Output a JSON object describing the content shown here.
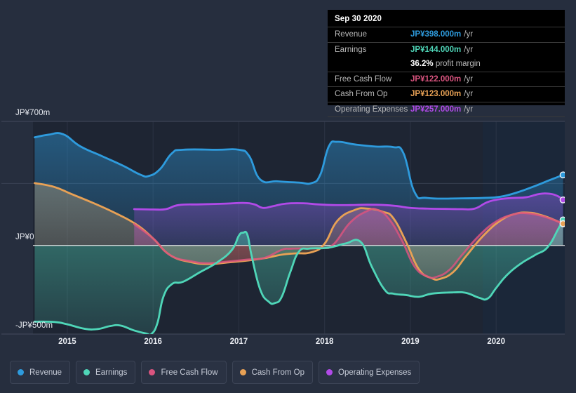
{
  "chart_data": {
    "type": "area",
    "title": "",
    "xlabel": "",
    "ylabel": "",
    "currency": "JP¥",
    "grid": true,
    "legend_position": "bottom",
    "ylim": [
      -500,
      700
    ],
    "y_ticks": [
      {
        "value": 700,
        "label": "JP¥700m"
      },
      {
        "value": 0,
        "label": "JP¥0"
      },
      {
        "value": -500,
        "label": "-JP¥500m"
      }
    ],
    "x_ticks": [
      "2015",
      "2016",
      "2017",
      "2018",
      "2019",
      "2020"
    ],
    "x_range": [
      "2014.6",
      "2020.8"
    ],
    "series": [
      {
        "name": "Revenue",
        "color": "#2e9bdd",
        "end_value": 398,
        "points": [
          [
            2014.62,
            610
          ],
          [
            2014.78,
            625
          ],
          [
            2014.95,
            628
          ],
          [
            2015.15,
            560
          ],
          [
            2015.4,
            505
          ],
          [
            2015.65,
            450
          ],
          [
            2015.85,
            400
          ],
          [
            2015.95,
            392
          ],
          [
            2016.08,
            430
          ],
          [
            2016.22,
            520
          ],
          [
            2016.35,
            540
          ],
          [
            2016.75,
            540
          ],
          [
            2017.0,
            540
          ],
          [
            2017.12,
            505
          ],
          [
            2017.25,
            372
          ],
          [
            2017.45,
            362
          ],
          [
            2017.7,
            355
          ],
          [
            2017.85,
            352
          ],
          [
            2017.95,
            400
          ],
          [
            2018.05,
            560
          ],
          [
            2018.15,
            585
          ],
          [
            2018.35,
            570
          ],
          [
            2018.6,
            558
          ],
          [
            2018.8,
            555
          ],
          [
            2018.92,
            520
          ],
          [
            2019.05,
            300
          ],
          [
            2019.2,
            268
          ],
          [
            2019.6,
            266
          ],
          [
            2019.85,
            268
          ],
          [
            2020.05,
            275
          ],
          [
            2020.25,
            300
          ],
          [
            2020.45,
            335
          ],
          [
            2020.62,
            368
          ],
          [
            2020.78,
            398
          ]
        ]
      },
      {
        "name": "Earnings",
        "color": "#4fd6b8",
        "end_value": 144,
        "points": [
          [
            2014.62,
            -430
          ],
          [
            2014.85,
            -432
          ],
          [
            2015.0,
            -445
          ],
          [
            2015.2,
            -470
          ],
          [
            2015.35,
            -472
          ],
          [
            2015.5,
            -455
          ],
          [
            2015.62,
            -452
          ],
          [
            2015.78,
            -480
          ],
          [
            2015.92,
            -497
          ],
          [
            2015.98,
            -500
          ],
          [
            2016.05,
            -440
          ],
          [
            2016.12,
            -290
          ],
          [
            2016.22,
            -218
          ],
          [
            2016.35,
            -205
          ],
          [
            2016.55,
            -150
          ],
          [
            2016.75,
            -95
          ],
          [
            2016.92,
            -25
          ],
          [
            2017.0,
            55
          ],
          [
            2017.05,
            72
          ],
          [
            2017.1,
            60
          ],
          [
            2017.15,
            -60
          ],
          [
            2017.25,
            -250
          ],
          [
            2017.35,
            -318
          ],
          [
            2017.42,
            -325
          ],
          [
            2017.5,
            -290
          ],
          [
            2017.6,
            -150
          ],
          [
            2017.7,
            -35
          ],
          [
            2017.82,
            -18
          ],
          [
            2018.0,
            -15
          ],
          [
            2018.12,
            -5
          ],
          [
            2018.25,
            12
          ],
          [
            2018.42,
            20
          ],
          [
            2018.55,
            -120
          ],
          [
            2018.7,
            -250
          ],
          [
            2018.8,
            -272
          ],
          [
            2018.95,
            -280
          ],
          [
            2019.1,
            -290
          ],
          [
            2019.25,
            -272
          ],
          [
            2019.5,
            -265
          ],
          [
            2019.65,
            -268
          ],
          [
            2019.8,
            -295
          ],
          [
            2019.9,
            -300
          ],
          [
            2020.0,
            -240
          ],
          [
            2020.12,
            -170
          ],
          [
            2020.28,
            -105
          ],
          [
            2020.45,
            -55
          ],
          [
            2020.6,
            -10
          ],
          [
            2020.72,
            90
          ],
          [
            2020.78,
            144
          ]
        ]
      },
      {
        "name": "Free Cash Flow",
        "color": "#d9547f",
        "end_value": 122,
        "points": [
          [
            2015.78,
            120
          ],
          [
            2016.0,
            40
          ],
          [
            2016.2,
            -55
          ],
          [
            2016.45,
            -90
          ],
          [
            2016.65,
            -100
          ],
          [
            2016.85,
            -92
          ],
          [
            2017.1,
            -80
          ],
          [
            2017.3,
            -70
          ],
          [
            2017.5,
            -25
          ],
          [
            2017.62,
            -18
          ],
          [
            2017.95,
            -15
          ],
          [
            2018.1,
            5
          ],
          [
            2018.3,
            130
          ],
          [
            2018.5,
            195
          ],
          [
            2018.62,
            200
          ],
          [
            2018.75,
            150
          ],
          [
            2018.9,
            30
          ],
          [
            2019.05,
            -120
          ],
          [
            2019.2,
            -175
          ],
          [
            2019.3,
            -178
          ],
          [
            2019.45,
            -140
          ],
          [
            2019.6,
            -55
          ],
          [
            2019.8,
            55
          ],
          [
            2020.0,
            135
          ],
          [
            2020.2,
            175
          ],
          [
            2020.35,
            182
          ],
          [
            2020.5,
            170
          ],
          [
            2020.65,
            148
          ],
          [
            2020.78,
            122
          ]
        ]
      },
      {
        "name": "Cash From Op",
        "color": "#e8a155",
        "end_value": 123,
        "points": [
          [
            2014.62,
            352
          ],
          [
            2014.85,
            330
          ],
          [
            2015.05,
            290
          ],
          [
            2015.3,
            240
          ],
          [
            2015.55,
            185
          ],
          [
            2015.8,
            120
          ],
          [
            2016.0,
            40
          ],
          [
            2016.2,
            -55
          ],
          [
            2016.45,
            -95
          ],
          [
            2016.65,
            -105
          ],
          [
            2016.85,
            -97
          ],
          [
            2017.1,
            -85
          ],
          [
            2017.3,
            -72
          ],
          [
            2017.5,
            -52
          ],
          [
            2017.65,
            -45
          ],
          [
            2017.85,
            -38
          ],
          [
            2018.0,
            10
          ],
          [
            2018.15,
            140
          ],
          [
            2018.35,
            200
          ],
          [
            2018.5,
            208
          ],
          [
            2018.68,
            190
          ],
          [
            2018.8,
            155
          ],
          [
            2018.95,
            20
          ],
          [
            2019.1,
            -135
          ],
          [
            2019.25,
            -185
          ],
          [
            2019.35,
            -188
          ],
          [
            2019.5,
            -150
          ],
          [
            2019.65,
            -60
          ],
          [
            2019.85,
            55
          ],
          [
            2020.05,
            140
          ],
          [
            2020.22,
            178
          ],
          [
            2020.38,
            185
          ],
          [
            2020.52,
            172
          ],
          [
            2020.66,
            148
          ],
          [
            2020.78,
            123
          ]
        ]
      },
      {
        "name": "Operating Expenses",
        "color": "#b14ae8",
        "end_value": 257,
        "points": [
          [
            2015.78,
            205
          ],
          [
            2016.0,
            203
          ],
          [
            2016.15,
            205
          ],
          [
            2016.3,
            228
          ],
          [
            2016.55,
            232
          ],
          [
            2016.85,
            236
          ],
          [
            2017.05,
            240
          ],
          [
            2017.18,
            232
          ],
          [
            2017.28,
            212
          ],
          [
            2017.4,
            222
          ],
          [
            2017.55,
            236
          ],
          [
            2017.75,
            238
          ],
          [
            2017.92,
            232
          ],
          [
            2018.1,
            228
          ],
          [
            2018.3,
            228
          ],
          [
            2018.5,
            230
          ],
          [
            2018.7,
            228
          ],
          [
            2018.85,
            222
          ],
          [
            2019.0,
            212
          ],
          [
            2019.2,
            208
          ],
          [
            2019.45,
            206
          ],
          [
            2019.6,
            205
          ],
          [
            2019.75,
            208
          ],
          [
            2019.9,
            245
          ],
          [
            2020.05,
            262
          ],
          [
            2020.2,
            268
          ],
          [
            2020.35,
            272
          ],
          [
            2020.5,
            290
          ],
          [
            2020.62,
            292
          ],
          [
            2020.72,
            278
          ],
          [
            2020.78,
            257
          ]
        ]
      }
    ]
  },
  "tooltip": {
    "date": "Sep 30 2020",
    "unit": "/yr",
    "rows": [
      {
        "label": "Revenue",
        "value": "JP¥398.000m",
        "color": "#2e9bdd"
      },
      {
        "label": "Earnings",
        "value": "JP¥144.000m",
        "color": "#4fd6b8"
      },
      {
        "label": "Free Cash Flow",
        "value": "JP¥122.000m",
        "color": "#d9547f"
      },
      {
        "label": "Cash From Op",
        "value": "JP¥123.000m",
        "color": "#e8a155"
      },
      {
        "label": "Operating Expenses",
        "value": "JP¥257.000m",
        "color": "#b14ae8"
      }
    ],
    "margin_value": "36.2%",
    "margin_label": "profit margin"
  },
  "legend": {
    "items": [
      {
        "label": "Revenue",
        "color": "#2e9bdd"
      },
      {
        "label": "Earnings",
        "color": "#4fd6b8"
      },
      {
        "label": "Free Cash Flow",
        "color": "#d9547f"
      },
      {
        "label": "Cash From Op",
        "color": "#e8a155"
      },
      {
        "label": "Operating Expenses",
        "color": "#b14ae8"
      }
    ]
  }
}
